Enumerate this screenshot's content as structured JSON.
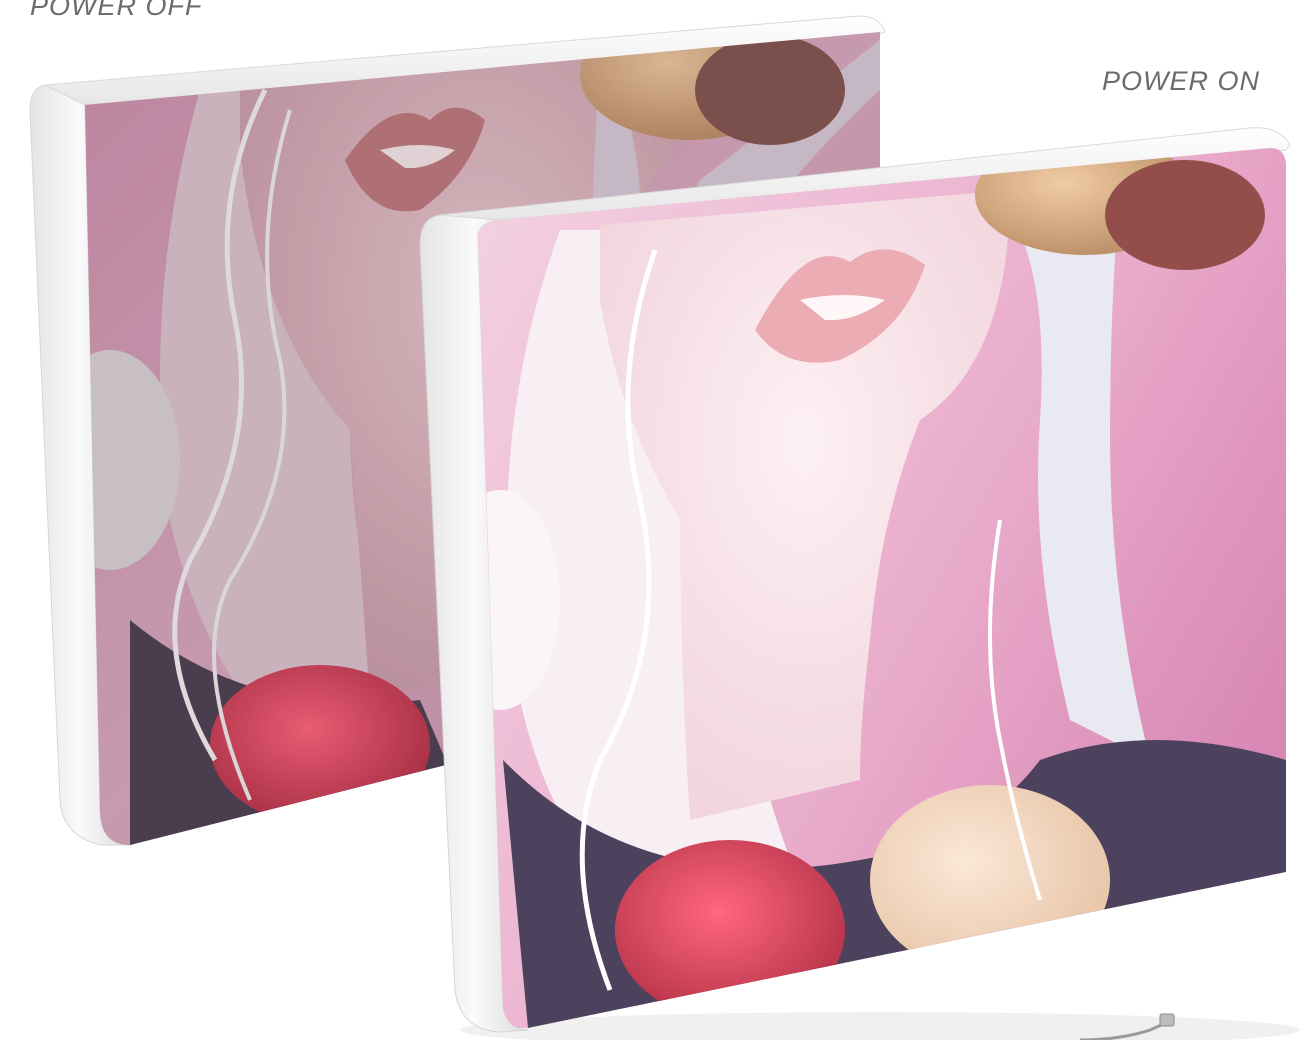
{
  "labels": {
    "power_off": "POWER OFF",
    "power_on": "POWER ON"
  },
  "colors": {
    "background": "#ffffff",
    "frame": "#f1f1f1",
    "frame_edge": "#d9d9d9",
    "backdrop_pink": "#d98fb4",
    "skin": "#f6dfe4",
    "hair": "#f3eaf0",
    "sweater": "#4a3a55",
    "pompom_red": "#d13b55",
    "pompom_gold": "#c9a077",
    "lips": "#d58f93",
    "label_text": "#6b6b6b"
  },
  "products": [
    {
      "name": "lightbox-off",
      "state": "off"
    },
    {
      "name": "lightbox-on",
      "state": "on"
    }
  ]
}
